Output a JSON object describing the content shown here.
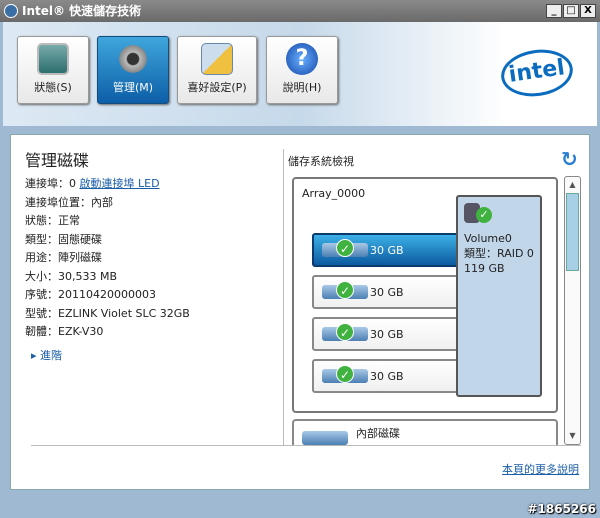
{
  "window": {
    "title": "Intel® 快速儲存技術",
    "minimize": "_",
    "maximize": "□",
    "close": "X"
  },
  "nav": [
    {
      "label": "狀態(S)",
      "icon": "monitor-icon"
    },
    {
      "label": "管理(M)",
      "icon": "gear-icon"
    },
    {
      "label": "喜好設定(P)",
      "icon": "clipboard-icon"
    },
    {
      "label": "說明(H)",
      "icon": "help-icon"
    }
  ],
  "logo": "intel",
  "left": {
    "title": "管理磁碟",
    "port": "連接埠：0",
    "led_link": "啟動連接埠 LED",
    "rows": [
      "連接埠位置：內部",
      "狀態：正常",
      "類型：固態硬碟",
      "用途：陣列磁碟",
      "大小：30,533 MB",
      "序號：20110420000003",
      "型號：EZLINK Violet SLC 32GB",
      "韌體：EZK-V30"
    ],
    "advanced": "進階"
  },
  "storage": {
    "title": "儲存系統檢視",
    "array": "Array_0000",
    "disks": [
      "30 GB",
      "30 GB",
      "30 GB",
      "30 GB"
    ],
    "volume": {
      "name": "Volume0",
      "type": "類型：RAID 0",
      "size": "119 GB"
    },
    "internal": "內部磁碟"
  },
  "footer": {
    "more_link": "本頁的更多說明"
  },
  "watermark": "#1865266"
}
